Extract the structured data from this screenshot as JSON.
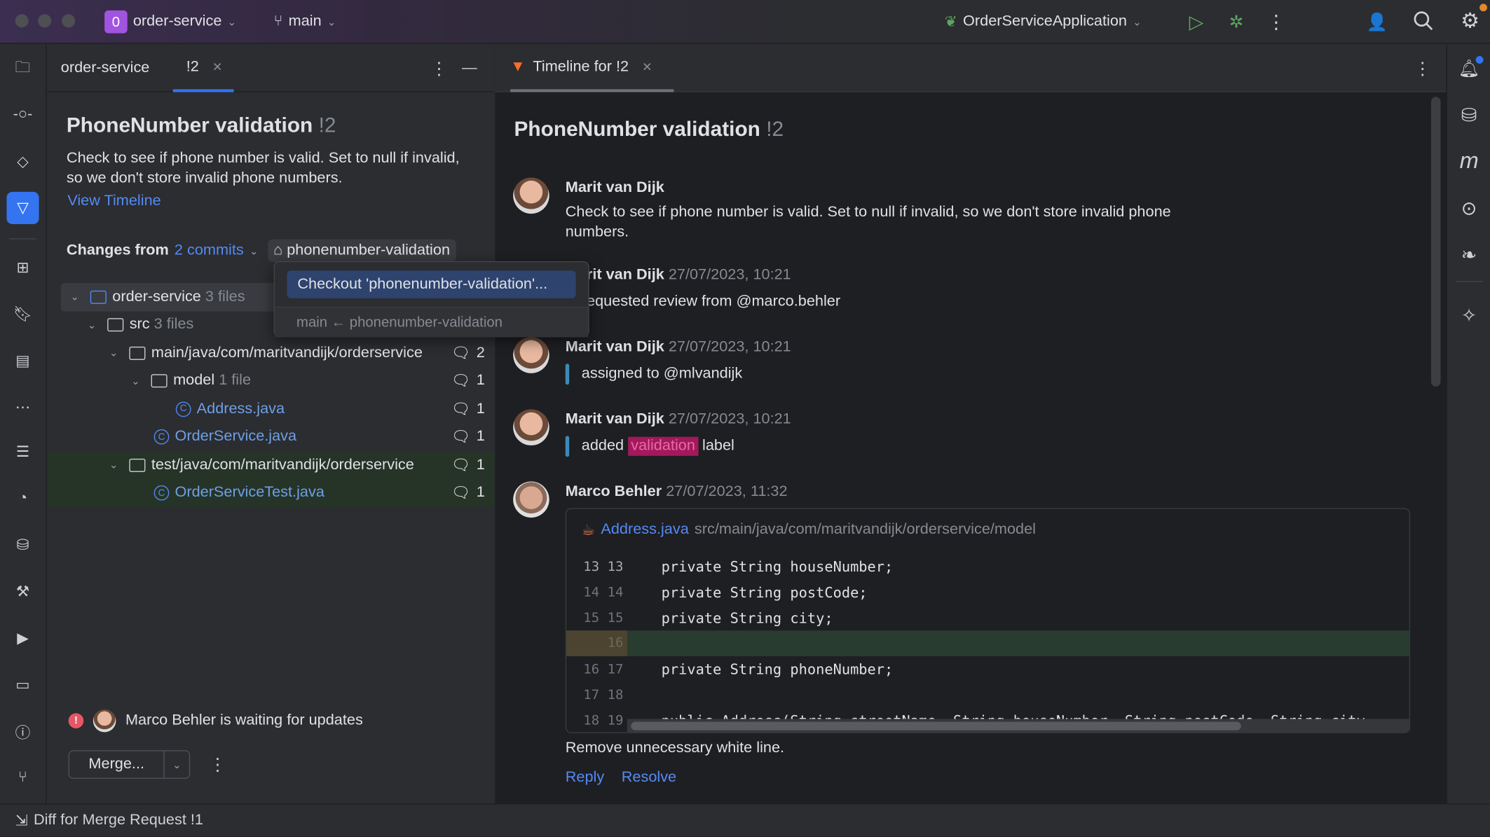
{
  "titlebar": {
    "project_badge": "0",
    "project": "order-service",
    "branch": "main",
    "run_config": "OrderServiceApplication"
  },
  "left_panel": {
    "tabs": [
      {
        "label": "order-service"
      },
      {
        "label": "!2"
      }
    ],
    "title": "PhoneNumber validation",
    "mr_id": "!2",
    "description": "Check to see if phone number is valid. Set to null if invalid, so we don't store invalid phone numbers.",
    "view_timeline": "View Timeline",
    "changes_from": "Changes from",
    "commits": "2 commits",
    "branch_tag": "phonenumber-validation",
    "tree": [
      {
        "name": "order-service",
        "meta": "3 files",
        "count": ""
      },
      {
        "name": "src",
        "meta": "3 files",
        "count": ""
      },
      {
        "name": "main/java/com/maritvandijk/orderservice",
        "meta": "",
        "count": "2"
      },
      {
        "name": "model",
        "meta": "1 file",
        "count": "1"
      },
      {
        "name": "Address.java",
        "meta": "",
        "count": "1"
      },
      {
        "name": "OrderService.java",
        "meta": "",
        "count": "1"
      },
      {
        "name": "test/java/com/maritvandijk/orderservice",
        "meta": "",
        "count": "1"
      },
      {
        "name": "OrderServiceTest.java",
        "meta": "",
        "count": "1"
      }
    ],
    "waiting": "Marco Behler is waiting for updates",
    "merge_button": "Merge..."
  },
  "popup": {
    "checkout": "Checkout 'phonenumber-validation'...",
    "info": "main ← phonenumber-validation"
  },
  "timeline": {
    "tab": "Timeline for !2",
    "title": "PhoneNumber validation",
    "mr_id": "!2",
    "entries": [
      {
        "author": "Marit van Dijk",
        "time": "",
        "text": "Check to see if phone number is valid. Set to null if invalid, so we don't store invalid phone numbers."
      },
      {
        "author": "Marit van Dijk",
        "time": "27/07/2023, 10:21",
        "text": "requested review from @marco.behler"
      },
      {
        "author": "Marit van Dijk",
        "time": "27/07/2023, 10:21",
        "text": "assigned to @mlvandijk"
      },
      {
        "author": "Marit van Dijk",
        "time": "27/07/2023, 10:21",
        "text_before": "added",
        "label": "validation",
        "text_after": "label"
      },
      {
        "author": "Marco Behler",
        "time": "27/07/2023, 11:32"
      }
    ],
    "label_color": "#a3195b",
    "diff": {
      "file": "Address.java",
      "path": "src/main/java/com/maritvandijk/orderservice/model",
      "lines": [
        {
          "ln": "13 13",
          "code": "private String houseNumber;"
        },
        {
          "ln": "14 14",
          "code": "private String postCode;"
        },
        {
          "ln": "15 15",
          "code": "private String city;"
        },
        {
          "ln": "   16",
          "code": "",
          "added": true
        },
        {
          "ln": "16 17",
          "code": "private String phoneNumber;"
        },
        {
          "ln": "17 18",
          "code": ""
        },
        {
          "ln": "18 19",
          "code": "public Address(String streetName, String houseNumber, String postCode, String city"
        }
      ]
    },
    "comment": "Remove unnecessary white line.",
    "reply": "Reply",
    "resolve": "Resolve"
  },
  "statusbar": {
    "text": "Diff for Merge Request !1"
  }
}
